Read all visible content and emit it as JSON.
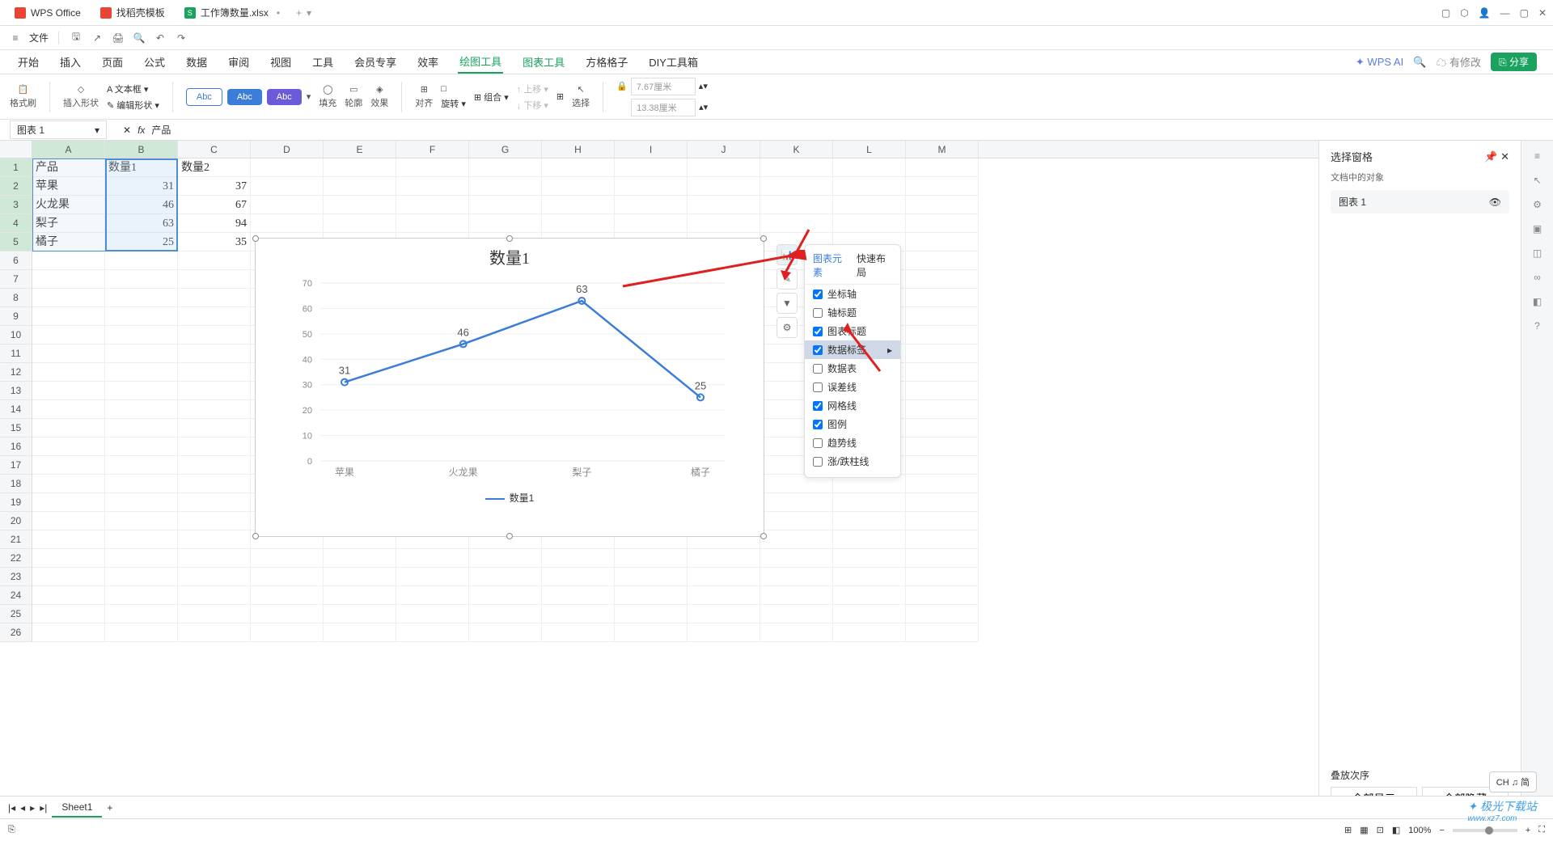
{
  "tabs": {
    "wps": "WPS Office",
    "template": "找稻壳模板",
    "file": "工作簿数量.xlsx"
  },
  "menu": {
    "file": "文件"
  },
  "ribbon": [
    "开始",
    "插入",
    "页面",
    "公式",
    "数据",
    "审阅",
    "视图",
    "工具",
    "会员专享",
    "效率",
    "绘图工具",
    "图表工具",
    "方格格子",
    "DIY工具箱"
  ],
  "ribbon_ai": "WPS AI",
  "ribbon_modify": "有修改",
  "ribbon_share": "分享",
  "toolbar": {
    "format": "格式刷",
    "insert_shape": "插入形状",
    "text_box": "文本框",
    "edit_shape": "编辑形状",
    "abc": "Abc",
    "fill": "填充",
    "outline": "轮廓",
    "effect": "效果",
    "align": "对齐",
    "flip": "□",
    "rotate": "旋转",
    "group": "组合",
    "up": "上移",
    "down": "下移",
    "grid_icon": "⊞",
    "select": "选择",
    "lock": "🔒",
    "w": "7.67厘米",
    "h": "13.38厘米"
  },
  "name_box": "图表 1",
  "formula": "产品",
  "columns": [
    "A",
    "B",
    "C",
    "D",
    "E",
    "F",
    "G",
    "H",
    "I",
    "J",
    "K",
    "L",
    "M"
  ],
  "data": {
    "headers": [
      "产品",
      "数量1",
      "数量2"
    ],
    "rows": [
      [
        "苹果",
        "31",
        "37"
      ],
      [
        "火龙果",
        "46",
        "67"
      ],
      [
        "梨子",
        "63",
        "94"
      ],
      [
        "橘子",
        "25",
        "35"
      ]
    ]
  },
  "chart_data": {
    "type": "line",
    "title": "数量1",
    "categories": [
      "苹果",
      "火龙果",
      "梨子",
      "橘子"
    ],
    "series": [
      {
        "name": "数量1",
        "values": [
          31,
          46,
          63,
          25
        ]
      }
    ],
    "ylim": [
      0,
      70
    ],
    "yticks": [
      0,
      10,
      20,
      30,
      40,
      50,
      60,
      70
    ],
    "legend": "数量1"
  },
  "popup": {
    "tab1": "图表元素",
    "tab2": "快速布局",
    "items": [
      {
        "label": "坐标轴",
        "checked": true
      },
      {
        "label": "轴标题",
        "checked": false
      },
      {
        "label": "图表标题",
        "checked": true
      },
      {
        "label": "数据标签",
        "checked": true,
        "hl": true
      },
      {
        "label": "数据表",
        "checked": false
      },
      {
        "label": "误差线",
        "checked": false
      },
      {
        "label": "网格线",
        "checked": true
      },
      {
        "label": "图例",
        "checked": true
      },
      {
        "label": "趋势线",
        "checked": false
      },
      {
        "label": "涨/跌柱线",
        "checked": false
      }
    ]
  },
  "right_panel": {
    "title": "选择窗格",
    "subtitle": "文档中的对象",
    "item": "图表 1",
    "stack": "叠放次序",
    "show_all": "全部显示",
    "hide_all": "全部隐藏"
  },
  "sheet": "Sheet1",
  "zoom": "100%",
  "ime": "CH ♫ 简",
  "watermark": "极光下载站",
  "watermark_url": "www.xz7.com"
}
